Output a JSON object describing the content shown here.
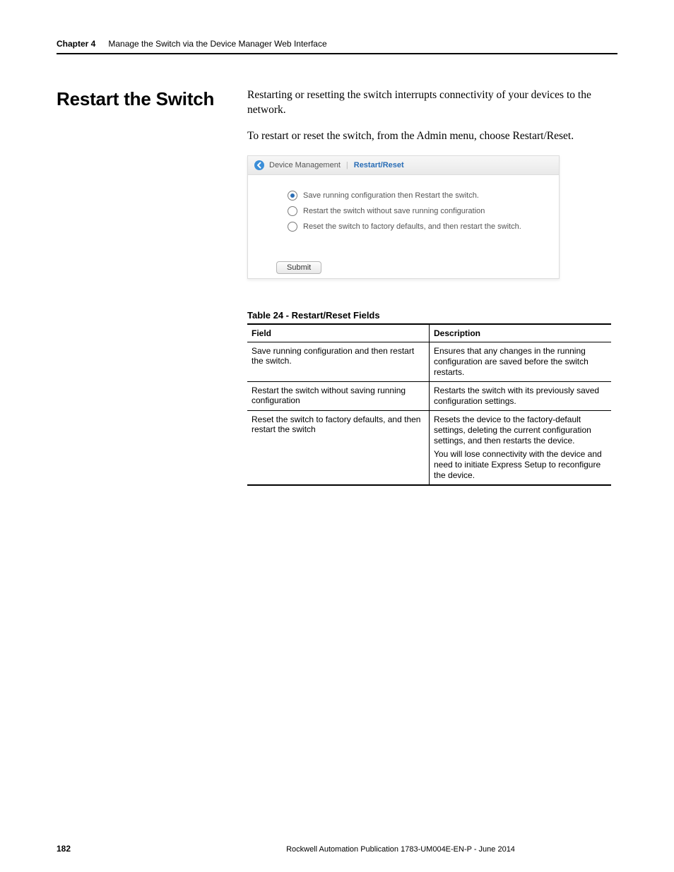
{
  "header": {
    "chapter": "Chapter 4",
    "title": "Manage the Switch via the Device Manager Web Interface"
  },
  "section_title": "Restart the Switch",
  "paragraphs": {
    "p1": "Restarting or resetting the switch interrupts connectivity of your devices to the network.",
    "p2": "To restart or reset the switch, from the Admin menu, choose Restart/Reset."
  },
  "ui": {
    "breadcrumb1": "Device Management",
    "breadcrumb2": "Restart/Reset",
    "options": [
      "Save running configuration then Restart the switch.",
      "Restart the switch without save running configuration",
      "Reset the switch to factory defaults, and then restart the switch."
    ],
    "selected_index": 0,
    "submit_label": "Submit"
  },
  "table": {
    "caption": "Table 24 - Restart/Reset Fields",
    "head": {
      "field": "Field",
      "desc": "Description"
    },
    "rows": [
      {
        "field": "Save running configuration and then restart the switch.",
        "desc": [
          "Ensures that any changes in the running configuration are saved before the switch restarts."
        ]
      },
      {
        "field": "Restart the switch without saving running configuration",
        "desc": [
          "Restarts the switch with its previously saved configuration settings."
        ]
      },
      {
        "field": "Reset the switch to factory defaults, and then restart the switch",
        "desc": [
          "Resets the device to the factory-default settings, deleting the current configuration settings, and then restarts the device.",
          "You will lose connectivity with the device and need to initiate Express Setup to reconfigure the device."
        ]
      }
    ]
  },
  "footer": {
    "page": "182",
    "pub": "Rockwell Automation Publication 1783-UM004E-EN-P - June 2014"
  }
}
